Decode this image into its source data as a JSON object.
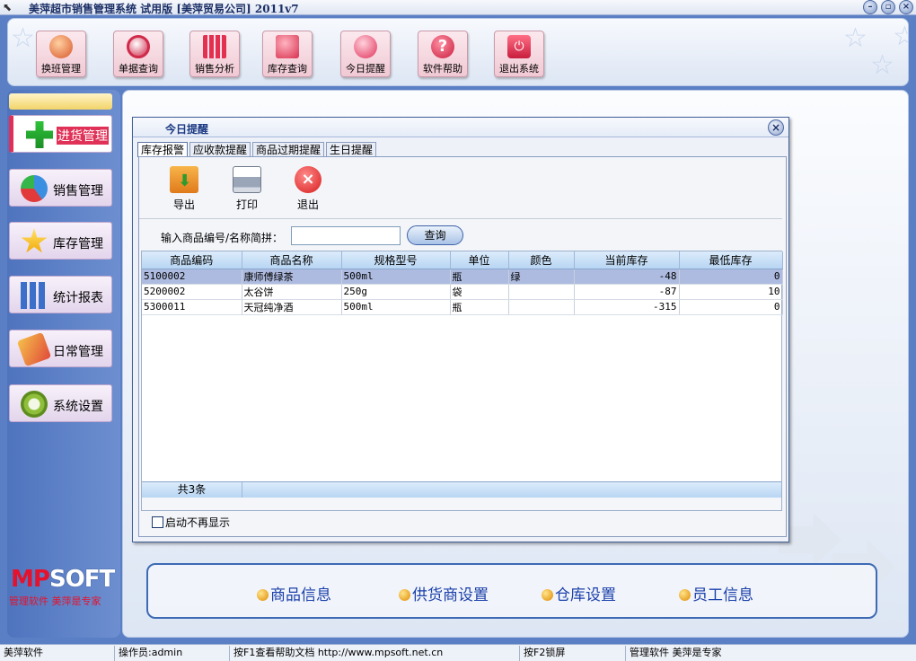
{
  "window": {
    "title": "美萍超市销售管理系统 试用版 [美萍贸易公司] 2011v7",
    "controls": [
      "minimize",
      "restore",
      "close"
    ]
  },
  "toolbar": {
    "buttons": [
      {
        "label": "换班管理",
        "icon": "users-icon"
      },
      {
        "label": "单据查询",
        "icon": "search-icon"
      },
      {
        "label": "销售分析",
        "icon": "bar-chart-icon"
      },
      {
        "label": "库存查询",
        "icon": "boxes-icon"
      },
      {
        "label": "今日提醒",
        "icon": "bulb-icon"
      },
      {
        "label": "软件帮助",
        "icon": "help-icon"
      },
      {
        "label": "退出系统",
        "icon": "power-icon"
      }
    ]
  },
  "sidebar": {
    "items": [
      {
        "label": "进货管理",
        "icon": "plus-icon",
        "active": true
      },
      {
        "label": "销售管理",
        "icon": "pie-chart-icon",
        "active": false
      },
      {
        "label": "库存管理",
        "icon": "star-icon",
        "active": false
      },
      {
        "label": "统计报表",
        "icon": "bars-icon",
        "active": false
      },
      {
        "label": "日常管理",
        "icon": "tools-icon",
        "active": false
      },
      {
        "label": "系统设置",
        "icon": "gear-icon",
        "active": false
      }
    ],
    "brand_mp": "MP",
    "brand_soft": "SOFT",
    "slogan": "管理软件 美萍是专家"
  },
  "dialog": {
    "title": "今日提醒",
    "tabs": [
      "库存报警",
      "应收款提醒",
      "商品过期提醒",
      "生日提醒"
    ],
    "active_tab": 0,
    "actions": [
      {
        "label": "导出",
        "icon": "export-icon"
      },
      {
        "label": "打印",
        "icon": "printer-icon"
      },
      {
        "label": "退出",
        "icon": "exit-icon"
      }
    ],
    "search": {
      "label": "输入商品编号/名称简拼：",
      "value": "",
      "button": "查询"
    },
    "table": {
      "columns": [
        "商品编码",
        "商品名称",
        "规格型号",
        "单位",
        "颜色",
        "当前库存",
        "最低库存"
      ],
      "rows": [
        [
          "5100002",
          "康师傅绿茶",
          "500ml",
          "瓶",
          "绿",
          "-48",
          "0"
        ],
        [
          "5200002",
          "太谷饼",
          "250g",
          "袋",
          "",
          "-87",
          "10"
        ],
        [
          "5300011",
          "天冠纯净酒",
          "500ml",
          "瓶",
          "",
          "-315",
          "0"
        ]
      ],
      "selected_row": 0,
      "footer_count": "共3条"
    },
    "dont_show_label": "启动不再显示",
    "dont_show_checked": false
  },
  "quick_links": [
    "商品信息",
    "供货商设置",
    "仓库设置",
    "员工信息"
  ],
  "statusbar": {
    "app": "美萍软件",
    "operator": "操作员:admin",
    "help": "按F1查看帮助文档 http://www.mpsoft.net.cn",
    "lock": "按F2锁屏",
    "slogan": "管理软件 美萍是专家"
  },
  "colors": {
    "frame_blue": "#5a7fc4",
    "active_red": "#e03157",
    "brand_red": "#e4122d",
    "link_blue": "#1b3faa",
    "selected_row": "#aebbe0"
  }
}
